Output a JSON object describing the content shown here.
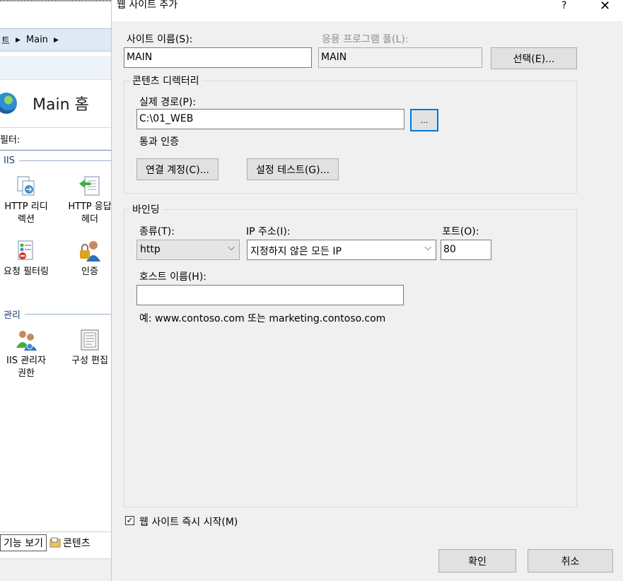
{
  "background": {
    "breadcrumb": [
      "트",
      "Main"
    ],
    "home_title": "Main 홈",
    "filter_label": "필터:",
    "groups": {
      "iis": "IIS",
      "management": "관리"
    },
    "tiles": [
      {
        "label": "HTTP 리디렉션",
        "icon": "http-redirect-icon"
      },
      {
        "label": "HTTP 응답 헤더",
        "icon": "http-response-headers-icon"
      },
      {
        "label": "요청 필터링",
        "icon": "request-filtering-icon"
      },
      {
        "label": "인증",
        "icon": "authentication-icon"
      },
      {
        "label": "IIS 관리자 권한",
        "icon": "iis-manager-permissions-icon"
      },
      {
        "label": "구성 편집",
        "icon": "configuration-editor-icon"
      }
    ],
    "bottom_tabs": {
      "features_view": "기능 보기",
      "content_view": "콘텐츠"
    }
  },
  "dialog": {
    "title": "웹 사이트 추가",
    "help_glyph": "?",
    "close_glyph": "✕",
    "site_name": {
      "label": "사이트 이름(S):",
      "value": "MAIN"
    },
    "app_pool": {
      "label": "응용 프로그램 풀(L):",
      "value": "MAIN",
      "select_label": "선택(E)..."
    },
    "content_dir": {
      "title": "콘텐츠 디렉터리",
      "path_label": "실제 경로(P):",
      "path_value": "C:\\01_WEB",
      "browse_label": "...",
      "pass_through_label": "통과 인증",
      "connect_as_label": "연결 계정(C)...",
      "test_settings_label": "설정 테스트(G)..."
    },
    "binding": {
      "title": "바인딩",
      "type_label": "종류(T):",
      "type_value": "http",
      "ip_label": "IP 주소(I):",
      "ip_value": "지정하지 않은 모든 IP",
      "port_label": "포트(O):",
      "port_value": "80",
      "host_label": "호스트 이름(H):",
      "host_value": "",
      "example": "예: www.contoso.com 또는 marketing.contoso.com"
    },
    "start_immediately": {
      "label": "웹 사이트 즉시 시작(M)",
      "checked": true,
      "check_glyph": "✓"
    },
    "ok_label": "확인",
    "cancel_label": "취소"
  }
}
